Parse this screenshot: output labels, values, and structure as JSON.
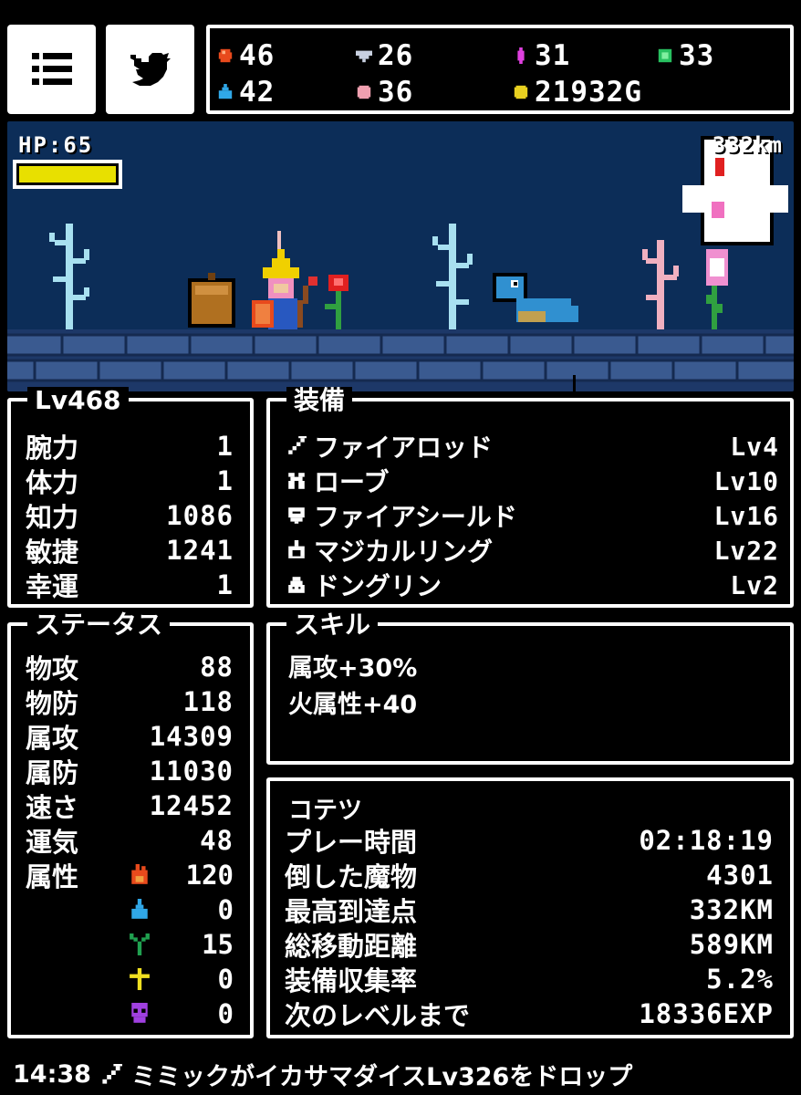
{
  "resources": {
    "fire": "46",
    "diamond": "26",
    "pink_crystal": "31",
    "green": "33",
    "water": "42",
    "pearl": "36",
    "gold": "21932G"
  },
  "colors": {
    "fire": "#e84a1c",
    "diamond": "#c8d0e0",
    "pink_crystal": "#e040e0",
    "green": "#28c060",
    "water": "#30a8e8",
    "pearl": "#f0a0b0",
    "gold": "#e8d020",
    "hp_bar": "#e8e000",
    "sea": "#0c2d58",
    "floor": "#3a5a90"
  },
  "game": {
    "hp_label": "HP:65",
    "distance": "332km",
    "hp_fraction": 1.0
  },
  "level_panel": {
    "title": "Lv468",
    "stats": [
      {
        "label": "腕力",
        "value": "1"
      },
      {
        "label": "体力",
        "value": "1"
      },
      {
        "label": "知力",
        "value": "1086"
      },
      {
        "label": "敏捷",
        "value": "1241"
      },
      {
        "label": "幸運",
        "value": "1"
      }
    ]
  },
  "equipment_panel": {
    "title": "装備",
    "items": [
      {
        "icon": "wand-icon",
        "name": "ファイアロッド",
        "level": "Lv4"
      },
      {
        "icon": "robe-icon",
        "name": "ローブ",
        "level": "Lv10"
      },
      {
        "icon": "shield-icon",
        "name": "ファイアシールド",
        "level": "Lv16"
      },
      {
        "icon": "ring-icon",
        "name": "マジカルリング",
        "level": "Lv22"
      },
      {
        "icon": "pet-icon",
        "name": "ドングリン",
        "level": "Lv2"
      }
    ]
  },
  "status_panel": {
    "title": "ステータス",
    "stats": [
      {
        "label": "物攻",
        "value": "88"
      },
      {
        "label": "物防",
        "value": "118"
      },
      {
        "label": "属攻",
        "value": "14309"
      },
      {
        "label": "属防",
        "value": "11030"
      },
      {
        "label": "速さ",
        "value": "12452"
      },
      {
        "label": "運気",
        "value": "48"
      }
    ],
    "attribute_label": "属性",
    "attributes": [
      {
        "icon": "fire-icon",
        "value": "120"
      },
      {
        "icon": "water-icon",
        "value": "0"
      },
      {
        "icon": "plant-icon",
        "value": "15"
      },
      {
        "icon": "holy-icon",
        "value": "0"
      },
      {
        "icon": "dark-icon",
        "value": "0"
      }
    ]
  },
  "skill_panel": {
    "title": "スキル",
    "skills": [
      "属攻+30%",
      "火属性+40"
    ]
  },
  "record_panel": {
    "name": "コテツ",
    "rows": [
      {
        "label": "プレー時間",
        "value": "02:18:19"
      },
      {
        "label": "倒した魔物",
        "value": "4301"
      },
      {
        "label": "最高到達点",
        "value": "332KM"
      },
      {
        "label": "総移動距離",
        "value": "589KM"
      },
      {
        "label": "装備収集率",
        "value": "5.2%"
      },
      {
        "label": "次のレベルまで",
        "value": "18336EXP"
      }
    ]
  },
  "footer": {
    "time": "14:38",
    "message": "ミミックがイカサマダイスLv326をドロップ"
  }
}
